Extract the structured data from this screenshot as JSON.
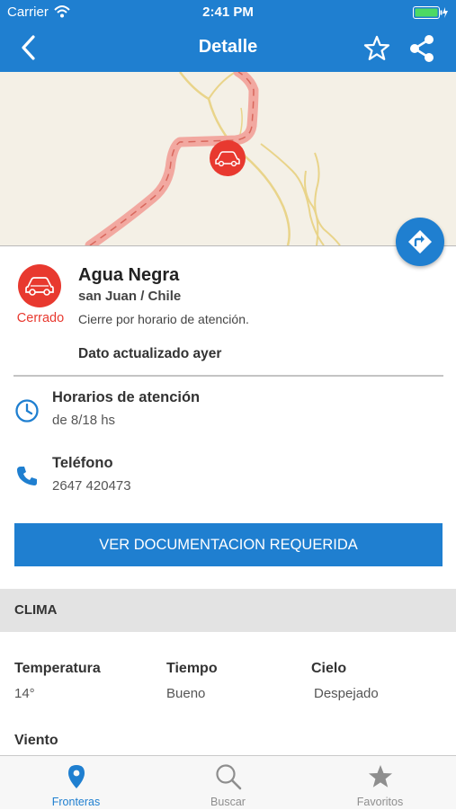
{
  "status_bar": {
    "carrier": "Carrier",
    "time": "2:41 PM"
  },
  "nav": {
    "title": "Detalle",
    "icons": [
      "back-chevron-icon",
      "star-outline-icon",
      "share-icon"
    ]
  },
  "crossing": {
    "name": "Agua Negra",
    "location": "san Juan / Chile",
    "status": "Cerrado",
    "status_color": "#e8392f",
    "description": "Cierre por horario de atención.",
    "updated": "Dato actualizado ayer"
  },
  "contact": {
    "hours_label": "Horarios de atención",
    "hours_value": "de 8/18 hs",
    "phone_label": "Teléfono",
    "phone_value": "2647 420473"
  },
  "documentation_button": "VER DOCUMENTACION REQUERIDA",
  "clima": {
    "title": "CLIMA",
    "items": [
      {
        "label": "Temperatura",
        "value": "14°"
      },
      {
        "label": "Tiempo",
        "value": "Bueno"
      },
      {
        "label": "Cielo",
        "value": "Despejado"
      },
      {
        "label": "Viento",
        "value": ""
      }
    ]
  },
  "tabs": [
    {
      "label": "Fronteras",
      "icon": "map-pin-icon",
      "active": true
    },
    {
      "label": "Buscar",
      "icon": "search-icon",
      "active": false
    },
    {
      "label": "Favoritos",
      "icon": "star-icon",
      "active": false
    }
  ],
  "colors": {
    "primary": "#1f7fd0",
    "closed": "#e8392f",
    "map_bg": "#f4f0e6"
  }
}
